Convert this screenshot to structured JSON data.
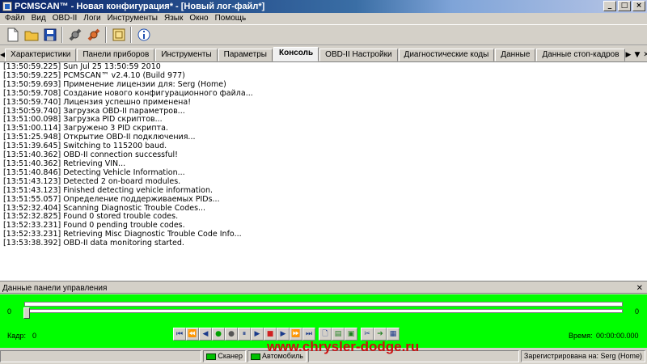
{
  "window": {
    "title": "PCMSCAN™ - Новая конфигурация* - [Новый лог-файл*]",
    "minimize_icon": "minimize-icon",
    "maximize_icon": "maximize-icon",
    "close_icon": "close-icon"
  },
  "menu": [
    "Файл",
    "Вид",
    "OBD-II",
    "Логи",
    "Инструменты",
    "Язык",
    "Окно",
    "Помощь"
  ],
  "toolbar": {
    "icons": [
      "new-file-icon",
      "open-folder-icon",
      "save-icon",
      "connect-icon",
      "disconnect-icon",
      "window-icon",
      "info-icon"
    ]
  },
  "tabs": {
    "items": [
      "Характеристики",
      "Панели приборов",
      "Инструменты",
      "Параметры",
      "Консоль",
      "OBD-II Настройки",
      "Диагностические коды",
      "Данные",
      "Данные стоп-кадров"
    ],
    "active": "Консоль"
  },
  "console": {
    "lines": [
      "[13:50:59.225] Sun Jul 25 13:50:59 2010",
      "[13:50:59.225] PCMSCAN™ v2.4.10 (Build 977)",
      "[13:50:59.693] Применение лицензии для: Serg (Home)",
      "[13:50:59.708] Создание нового конфигурационного файла...",
      "[13:50:59.740] Лицензия успешно применена!",
      "[13:50:59.740] Загрузка OBD-II параметров...",
      "[13:51:00.098] Загрузка PID скриптов...",
      "[13:51:00.114] Загружено 3 PID скрипта.",
      "[13:51:25.948] Открытие OBD-II подключения...",
      "[13:51:39.645] Switching to 115200 baud.",
      "[13:51:40.362] OBD-II connection successful!",
      "[13:51:40.362] Retrieving VIN...",
      "[13:51:40.846] Detecting Vehicle Information...",
      "[13:51:43.123] Detected 2 on-board modules.",
      "[13:51:43.123] Finished detecting vehicle information.",
      "[13:51:55.057] Определение поддерживаемых PIDs...",
      "[13:52:32.404] Scanning Diagnostic Trouble Codes...",
      "[13:52:32.825] Found 0 stored trouble codes.",
      "[13:52:33.231] Found 0 pending trouble codes.",
      "[13:52:33.231] Retrieving Misc Diagnostic Trouble Code Info...",
      "[13:53:38.392] OBD-II data monitoring started."
    ]
  },
  "panel": {
    "title": "Данные панели управления",
    "slider_left": "0",
    "slider_right": "0",
    "frame_label": "Кадр:",
    "frame_value": "0",
    "time_label": "Время:",
    "time_value": "00:00:00.000",
    "background_color": "#00ff00",
    "position_fraction": 0
  },
  "status": {
    "scanner_label": "Сканер",
    "vehicle_label": "Автомобиль",
    "registered": "Зарегистрирована на: Serg (Home)",
    "scanner_led_color": "#00c000",
    "vehicle_led_color": "#00c000"
  },
  "watermark": "www.chrysler-dodge.ru"
}
